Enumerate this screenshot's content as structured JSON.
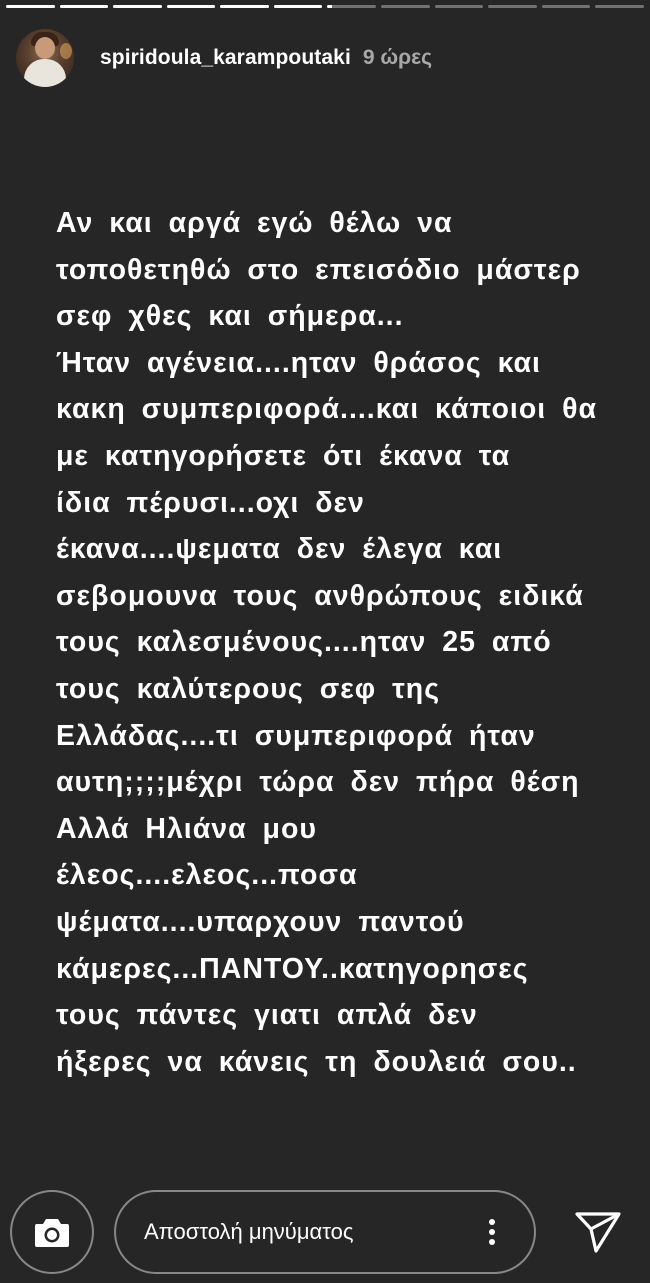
{
  "story": {
    "segments_total": 12,
    "segments_viewed": 6,
    "current_segment_progress": 0.1
  },
  "header": {
    "username": "spiridoula_karampoutaki",
    "time": "9 ώρες",
    "avatar_icon": "profile-photo"
  },
  "body_text": {
    "lines": [
      "Αν και αργά εγώ θέλω να",
      "τοποθετηθώ στο επεισόδιο μάστερ",
      "σεφ χθες και σήμερα...",
      "Ήταν αγένεια....ηταν θράσος και",
      "κακη συμπεριφορά....και κάποιοι θα",
      "με κατηγορήσετε ότι έκανα τα",
      "ίδια πέρυσι...οχι δεν",
      "έκανα....ψεματα δεν έλεγα και",
      "σεβομουνα τους ανθρώπους ειδικά",
      "τους καλεσμένους....ηταν 25 από",
      "τους καλύτερους σεφ της",
      "Ελλάδας....τι συμπεριφορά ήταν",
      "αυτη;;;;μέχρι τώρα δεν πήρα θέση",
      "Αλλά Ηλιάνα μου",
      "έλεος....ελεος...ποσα",
      "ψέματα....υπαρχουν παντού",
      "κάμερες...ΠΑΝΤΟΥ..κατηγορησες",
      "τους πάντες γιατι απλά δεν",
      "ήξερες να κάνεις τη δουλειά σου.."
    ]
  },
  "footer": {
    "camera_icon": "camera-icon",
    "message_placeholder": "Αποστολή μηνύματος",
    "more_icon": "more-vertical-icon",
    "send_icon": "send-icon"
  },
  "colors": {
    "background": "#262626",
    "text": "#ffffff",
    "muted": "#999999"
  }
}
